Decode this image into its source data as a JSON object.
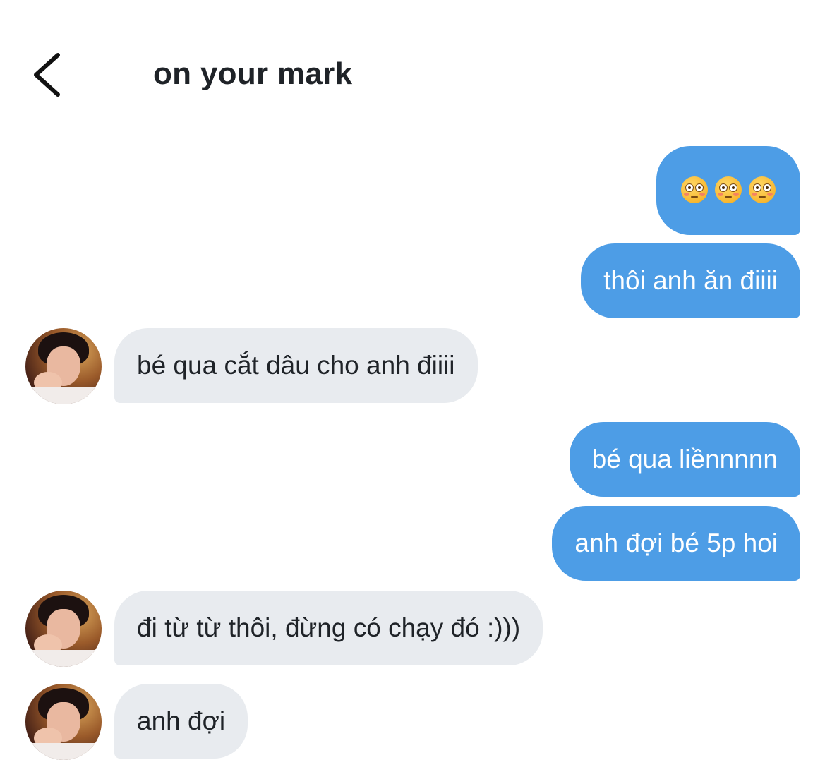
{
  "header": {
    "title": "on your mark",
    "back_icon": "chevron-left-icon"
  },
  "colors": {
    "outgoing_bubble": "#4d9de6",
    "incoming_bubble": "#e8ebef",
    "text_dark": "#1f2328"
  },
  "messages": [
    {
      "direction": "outgoing",
      "type": "emoji",
      "emoji": "flushed-face",
      "count": 3
    },
    {
      "direction": "outgoing",
      "text": "thôi anh ăn điiii"
    },
    {
      "direction": "incoming",
      "text": "bé qua cắt dâu cho anh điiii",
      "avatar": "contact-avatar"
    },
    {
      "direction": "outgoing",
      "text": "bé qua liềnnnnn"
    },
    {
      "direction": "outgoing",
      "text": "anh đợi bé 5p hoi"
    },
    {
      "direction": "incoming",
      "text": "đi từ từ thôi, đừng có chạy đó :)))",
      "avatar": "contact-avatar"
    },
    {
      "direction": "incoming",
      "text": "anh đợi",
      "avatar": "contact-avatar"
    }
  ]
}
